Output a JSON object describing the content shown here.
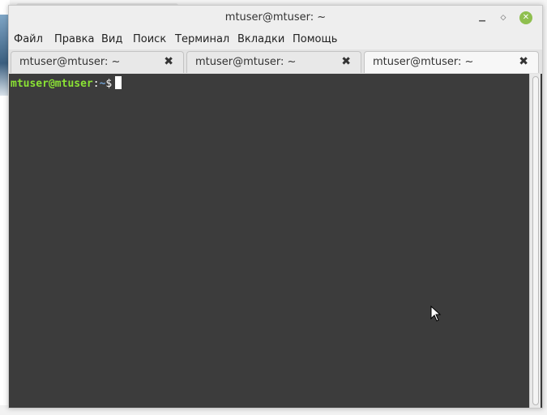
{
  "window": {
    "title": "mtuser@mtuser: ~"
  },
  "menu": [
    "Файл",
    "Правка",
    "Вид",
    "Поиск",
    "Терминал",
    "Вкладки",
    "Помощь"
  ],
  "tabs": [
    {
      "label": "mtuser@mtuser: ~",
      "active": false
    },
    {
      "label": "mtuser@mtuser: ~",
      "active": false
    },
    {
      "label": "mtuser@mtuser: ~",
      "active": true
    }
  ],
  "terminal": {
    "prompt_user": "mtuser@mtuser",
    "prompt_separator": ":",
    "prompt_path": "~",
    "prompt_symbol": "$"
  },
  "colors": {
    "terminal_background": "#3c3c3c",
    "prompt_user": "#8ae234",
    "prompt_path": "#729fcf",
    "close_button": "#8fbf4f"
  }
}
